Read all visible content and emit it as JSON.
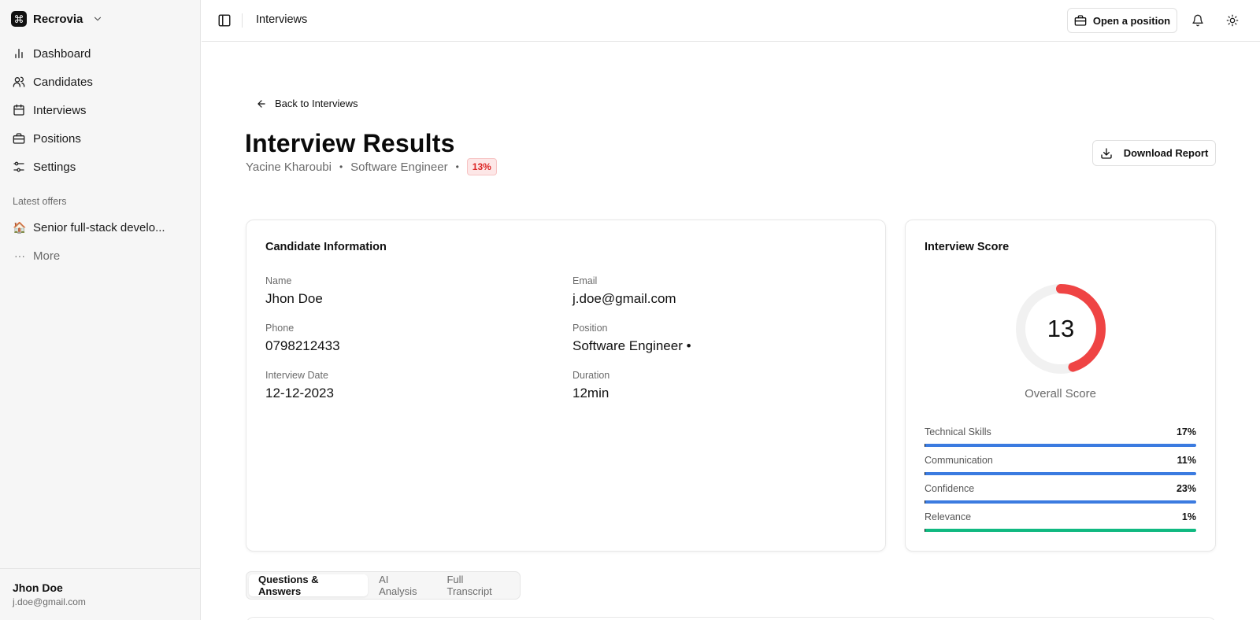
{
  "app": {
    "name": "Recrovia"
  },
  "sidebar": {
    "nav": [
      {
        "label": "Dashboard",
        "icon": "bar-chart-icon"
      },
      {
        "label": "Candidates",
        "icon": "users-icon"
      },
      {
        "label": "Interviews",
        "icon": "calendar-icon"
      },
      {
        "label": "Positions",
        "icon": "briefcase-icon"
      },
      {
        "label": "Settings",
        "icon": "sliders-icon"
      }
    ],
    "offers_label": "Latest offers",
    "offers": [
      {
        "emoji": "🏠",
        "label": "Senior full-stack develo..."
      }
    ],
    "more_label": "More",
    "user": {
      "name": "Jhon Doe",
      "email": "j.doe@gmail.com"
    }
  },
  "topbar": {
    "title": "Interviews",
    "open_position_label": "Open a position"
  },
  "page": {
    "back_label": "Back to Interviews",
    "title": "Interview Results",
    "candidate_name": "Yacine Kharoubi",
    "role": "Software Engineer",
    "score_badge": "13%",
    "download_label": "Download Report"
  },
  "candidate_info": {
    "title": "Candidate Information",
    "fields": [
      {
        "label": "Name",
        "value": "Jhon Doe"
      },
      {
        "label": "Email",
        "value": "j.doe@gmail.com"
      },
      {
        "label": "Phone",
        "value": "0798212433"
      },
      {
        "label": "Position",
        "value": "Software Engineer •"
      },
      {
        "label": "Interview Date",
        "value": "12-12-2023"
      },
      {
        "label": "Duration",
        "value": "12min"
      }
    ]
  },
  "score": {
    "title": "Interview Score",
    "overall": 13,
    "overall_display": "13",
    "overall_label": "Overall Score",
    "gauge_color": "#ef4444",
    "metrics": [
      {
        "name": "Technical Skills",
        "value": "17%",
        "fraction": 0.17,
        "color": "#3b7be0"
      },
      {
        "name": "Communication",
        "value": "11%",
        "fraction": 0.11,
        "color": "#3b7be0"
      },
      {
        "name": "Confidence",
        "value": "23%",
        "fraction": 0.23,
        "color": "#3b7be0"
      },
      {
        "name": "Relevance",
        "value": "1%",
        "fraction": 0.01,
        "color": "#10b981"
      }
    ]
  },
  "tabs": [
    {
      "label": "Questions & Answers",
      "active": true
    },
    {
      "label": "AI Analysis",
      "active": false
    },
    {
      "label": "Full Transcript",
      "active": false
    }
  ]
}
